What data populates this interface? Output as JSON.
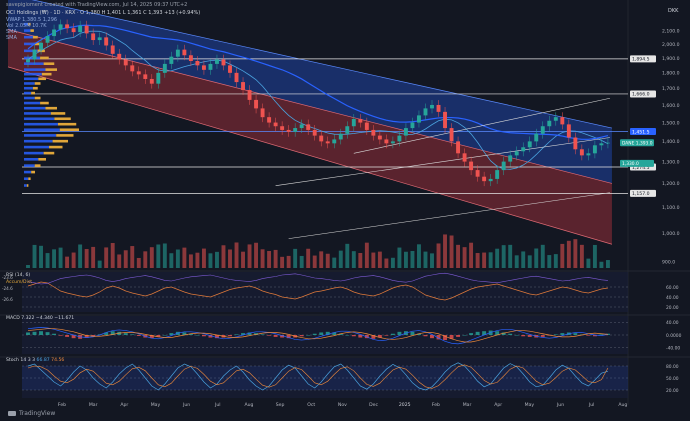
{
  "header": {
    "credit": "savepigioment created with TradingView.com, Jul 14, 2025 09:37 UTC+2",
    "symbol_line": "OCI Holdings (₩) · 1D · KRX · O 1,380 H 1,401 L 1,361 C 1,393 +13 (+0.94%)",
    "indicators": [
      "VWAP 1,380.5 1,296",
      "Vol 2.05M 10.7K",
      "SMA",
      "SMA"
    ]
  },
  "brand": {
    "name": "TradingView"
  },
  "colors": {
    "background": "#131722",
    "channel_upper": "#2962ff",
    "channel_lower": "#b2333e",
    "up": "#26a69a",
    "down": "#ef5350",
    "volume_profile": "#e0a63a",
    "sma_blue": "#2962ff",
    "sma_light": "#4aa3df",
    "price_badge": "#26a69a"
  },
  "chart_data": [
    {
      "type": "candlestick",
      "title": "",
      "currency_label": "DKK",
      "x_ticks": [
        "Feb",
        "Mar",
        "Apr",
        "May",
        "Jun",
        "Jul",
        "Aug",
        "Sep",
        "Oct",
        "Nov",
        "Dec",
        "2025",
        "Feb",
        "Mar",
        "Apr",
        "May",
        "Jun",
        "Jul",
        "Aug"
      ],
      "y_scale": "log",
      "ylim": [
        880,
        2300
      ],
      "y_ticks": [
        900,
        1000,
        1100,
        1200,
        1300,
        1400,
        1500,
        1600,
        1700,
        1800,
        1900,
        2000,
        2100
      ],
      "y_tick_labels": [
        "900.0",
        "1,000.0",
        "1,100.0",
        "1,200.0",
        "1,300.0",
        "1,400.0",
        "1,500.0",
        "1,600.0",
        "1,700.0",
        "1,800.0",
        "1,900.0",
        "2,000.0",
        "2,100.0"
      ],
      "horizontal_levels": [
        {
          "value": 1894.5,
          "label": "1,894.5",
          "style": "white"
        },
        {
          "value": 1666.0,
          "label": "1,666.0",
          "style": "white"
        },
        {
          "value": 1451.5,
          "label": "1,451.5",
          "style": "blue"
        },
        {
          "value": 1274.5,
          "label": "1,274.5",
          "style": "white"
        },
        {
          "value": 1157.0,
          "label": "1,157.0",
          "style": "white"
        }
      ],
      "price_badges": [
        {
          "value": 1393.0,
          "label": "DANE 1,393.0"
        },
        {
          "value": 1330.0,
          "label": "1,330.0"
        }
      ],
      "closes": [
        1890,
        1960,
        2010,
        2060,
        2110,
        2150,
        2120,
        2090,
        2140,
        2080,
        2030,
        2050,
        1990,
        1930,
        1890,
        1850,
        1810,
        1790,
        1760,
        1730,
        1800,
        1860,
        1910,
        1960,
        1920,
        1880,
        1850,
        1820,
        1860,
        1890,
        1850,
        1800,
        1740,
        1690,
        1630,
        1580,
        1530,
        1500,
        1480,
        1460,
        1450,
        1470,
        1490,
        1460,
        1430,
        1400,
        1390,
        1410,
        1440,
        1480,
        1520,
        1500,
        1460,
        1430,
        1410,
        1390,
        1400,
        1430,
        1470,
        1500,
        1540,
        1580,
        1600,
        1560,
        1470,
        1400,
        1340,
        1300,
        1260,
        1230,
        1210,
        1220,
        1260,
        1300,
        1330,
        1350,
        1370,
        1400,
        1440,
        1480,
        1510,
        1530,
        1490,
        1420,
        1360,
        1330,
        1340,
        1380,
        1390,
        1393
      ],
      "volume_profile_bars": [
        {
          "price": 2150,
          "size": 0.12
        },
        {
          "price": 2100,
          "size": 0.18
        },
        {
          "price": 2050,
          "size": 0.25
        },
        {
          "price": 2000,
          "size": 0.3
        },
        {
          "price": 1950,
          "size": 0.38
        },
        {
          "price": 1900,
          "size": 0.45
        },
        {
          "price": 1860,
          "size": 0.55
        },
        {
          "price": 1820,
          "size": 0.6
        },
        {
          "price": 1790,
          "size": 0.5
        },
        {
          "price": 1760,
          "size": 0.4
        },
        {
          "price": 1730,
          "size": 0.3
        },
        {
          "price": 1700,
          "size": 0.25
        },
        {
          "price": 1670,
          "size": 0.2
        },
        {
          "price": 1640,
          "size": 0.3
        },
        {
          "price": 1610,
          "size": 0.45
        },
        {
          "price": 1580,
          "size": 0.6
        },
        {
          "price": 1550,
          "size": 0.75
        },
        {
          "price": 1520,
          "size": 0.85
        },
        {
          "price": 1490,
          "size": 0.95
        },
        {
          "price": 1460,
          "size": 1.0
        },
        {
          "price": 1430,
          "size": 0.9
        },
        {
          "price": 1400,
          "size": 0.8
        },
        {
          "price": 1370,
          "size": 0.7
        },
        {
          "price": 1340,
          "size": 0.55
        },
        {
          "price": 1310,
          "size": 0.4
        },
        {
          "price": 1280,
          "size": 0.3
        },
        {
          "price": 1250,
          "size": 0.2
        },
        {
          "price": 1220,
          "size": 0.12
        },
        {
          "price": 1190,
          "size": 0.08
        }
      ],
      "volume_max_label": "900.0"
    },
    {
      "type": "line",
      "title": "RSI 14 close",
      "legend": [
        "RSI (14, 6)",
        "Accum/Dist"
      ],
      "y_ticks": [
        20,
        40,
        60
      ],
      "left_labels": [
        "-23.6",
        "-24.6",
        "-26.6"
      ],
      "ylim": [
        10,
        90
      ],
      "rsi": [
        62,
        66,
        70,
        68,
        60,
        52,
        48,
        45,
        42,
        40,
        44,
        50,
        58,
        62,
        58,
        52,
        48,
        45,
        42,
        46,
        52,
        58,
        60,
        55,
        50,
        46,
        44,
        42,
        40,
        45,
        50,
        55,
        58,
        60,
        62,
        58,
        52,
        48,
        45,
        40,
        38,
        36,
        40,
        45,
        50,
        52,
        55,
        58,
        60,
        56,
        50,
        46,
        44,
        42,
        46,
        52,
        58,
        62,
        64,
        60,
        52,
        44,
        40,
        36,
        34,
        38,
        44,
        50,
        56,
        60,
        62,
        64,
        66,
        62,
        58,
        54,
        50,
        46,
        44,
        48,
        52,
        56,
        60,
        58,
        54,
        50,
        48,
        52,
        56,
        58
      ]
    },
    {
      "type": "histogram",
      "title": "MACD",
      "legend": [
        "MACD 7.322 −4.340 −11.671"
      ],
      "y_ticks": [
        -40,
        0,
        40
      ],
      "y_tick_labels": [
        "-40.00",
        "0.0000",
        "40.00"
      ],
      "ylim": [
        -60,
        60
      ],
      "histogram": [
        8,
        10,
        12,
        9,
        4,
        -2,
        -6,
        -10,
        -12,
        -9,
        -5,
        2,
        8,
        12,
        10,
        6,
        2,
        -3,
        -8,
        -10,
        -6,
        0,
        6,
        10,
        8,
        4,
        0,
        -4,
        -8,
        -10,
        -8,
        -4,
        2,
        6,
        8,
        6,
        2,
        -2,
        -6,
        -8,
        -10,
        -8,
        -4,
        0,
        4,
        8,
        10,
        8,
        4,
        0,
        -4,
        -8,
        -10,
        -12,
        -8,
        -2,
        4,
        10,
        12,
        10,
        4,
        -4,
        -10,
        -14,
        -16,
        -12,
        -6,
        0,
        6,
        10,
        12,
        14,
        12,
        8,
        4,
        0,
        -4,
        -6,
        -8,
        -6,
        -2,
        2,
        6,
        8,
        6,
        2,
        -2,
        -4,
        2,
        4
      ],
      "macd": [
        20,
        22,
        24,
        22,
        18,
        12,
        6,
        0,
        -6,
        -8,
        -6,
        0,
        8,
        14,
        16,
        14,
        10,
        4,
        -4,
        -10,
        -12,
        -8,
        -2,
        6,
        10,
        10,
        8,
        4,
        -2,
        -8,
        -12,
        -10,
        -6,
        0,
        6,
        10,
        10,
        8,
        4,
        -2,
        -8,
        -14,
        -16,
        -14,
        -10,
        -4,
        2,
        8,
        12,
        12,
        8,
        2,
        -6,
        -14,
        -18,
        -16,
        -10,
        -2,
        6,
        12,
        14,
        10,
        2,
        -10,
        -20,
        -26,
        -28,
        -24,
        -16,
        -8,
        0,
        8,
        14,
        18,
        18,
        14,
        8,
        2,
        -4,
        -8,
        -10,
        -8,
        -2,
        4,
        8,
        8,
        4,
        0,
        -2,
        2
      ],
      "signal": [
        14,
        16,
        18,
        20,
        20,
        18,
        14,
        10,
        4,
        -2,
        -4,
        -4,
        -2,
        2,
        6,
        8,
        8,
        6,
        2,
        -2,
        -6,
        -8,
        -8,
        -4,
        0,
        4,
        6,
        6,
        4,
        0,
        -4,
        -8,
        -8,
        -6,
        -2,
        2,
        6,
        8,
        8,
        6,
        2,
        -4,
        -8,
        -12,
        -12,
        -10,
        -6,
        -2,
        4,
        8,
        10,
        8,
        4,
        -2,
        -8,
        -12,
        -14,
        -12,
        -8,
        -2,
        4,
        8,
        8,
        4,
        -4,
        -12,
        -18,
        -22,
        -22,
        -18,
        -12,
        -6,
        0,
        6,
        10,
        14,
        14,
        12,
        8,
        4,
        0,
        -4,
        -6,
        -6,
        -4,
        0,
        4,
        6,
        4,
        2
      ]
    },
    {
      "type": "line",
      "title": "Stoch",
      "legend": [
        "Stoch 14 3 3",
        "66.87",
        "74.56"
      ],
      "y_ticks": [
        20,
        50,
        80
      ],
      "y_tick_labels": [
        "20.00",
        "50.00",
        "80.00"
      ],
      "ylim": [
        0,
        100
      ],
      "k": [
        80,
        85,
        70,
        55,
        40,
        30,
        45,
        65,
        80,
        70,
        50,
        35,
        25,
        40,
        60,
        75,
        85,
        70,
        50,
        30,
        20,
        35,
        55,
        75,
        85,
        78,
        60,
        40,
        25,
        35,
        55,
        70,
        80,
        65,
        45,
        30,
        20,
        30,
        50,
        70,
        82,
        75,
        55,
        35,
        25,
        40,
        60,
        78,
        85,
        70,
        50,
        30,
        22,
        35,
        55,
        72,
        84,
        76,
        58,
        38,
        25,
        20,
        28,
        45,
        65,
        80,
        88,
        80,
        62,
        42,
        28,
        35,
        55,
        75,
        86,
        78,
        60,
        40,
        28,
        32,
        50,
        70,
        82,
        74,
        55,
        38,
        30,
        45,
        62,
        67
      ],
      "d": [
        75,
        80,
        78,
        70,
        55,
        42,
        38,
        47,
        63,
        72,
        67,
        52,
        37,
        33,
        42,
        58,
        73,
        77,
        68,
        50,
        33,
        28,
        37,
        55,
        72,
        79,
        74,
        59,
        42,
        33,
        38,
        53,
        68,
        72,
        63,
        47,
        32,
        27,
        33,
        50,
        67,
        76,
        71,
        55,
        38,
        33,
        42,
        59,
        74,
        78,
        68,
        50,
        34,
        29,
        37,
        54,
        70,
        77,
        72,
        57,
        40,
        28,
        24,
        31,
        46,
        63,
        78,
        83,
        77,
        61,
        44,
        35,
        39,
        55,
        72,
        80,
        75,
        59,
        42,
        33,
        37,
        51,
        67,
        75,
        70,
        56,
        41,
        38,
        46,
        75
      ]
    }
  ]
}
